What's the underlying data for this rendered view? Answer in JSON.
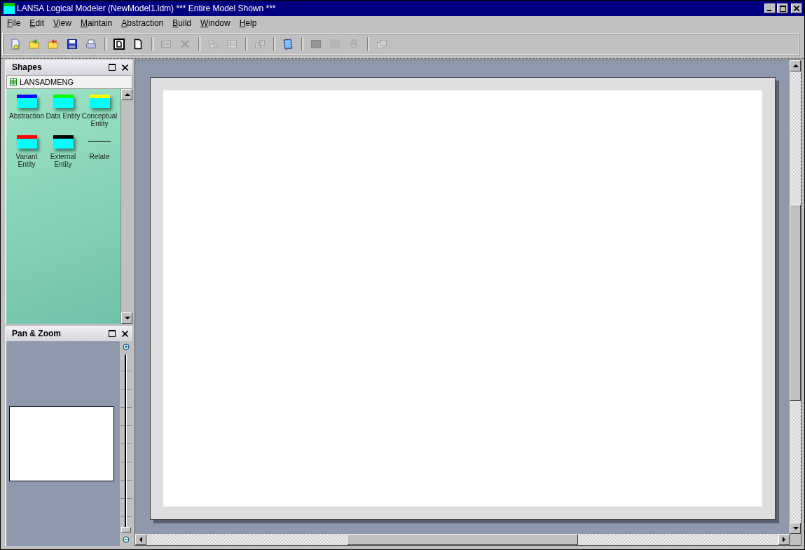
{
  "window": {
    "title": "LANSA Logical Modeler (NewModel1.ldm) *** Entire Model Shown ***"
  },
  "menu": [
    "File",
    "Edit",
    "View",
    "Maintain",
    "Abstraction",
    "Build",
    "Window",
    "Help"
  ],
  "toolbar": [
    [
      {
        "kind": "new",
        "disabled": false
      },
      {
        "kind": "import",
        "disabled": false
      },
      {
        "kind": "export",
        "disabled": false
      },
      {
        "kind": "save",
        "disabled": false
      },
      {
        "kind": "print",
        "disabled": false
      }
    ],
    [
      {
        "kind": "page-bold",
        "disabled": false
      },
      {
        "kind": "page",
        "disabled": false
      }
    ],
    [
      {
        "kind": "properties",
        "disabled": true
      },
      {
        "kind": "delete",
        "disabled": true
      }
    ],
    [
      {
        "kind": "cubes",
        "disabled": true
      },
      {
        "kind": "table",
        "disabled": true
      }
    ],
    [
      {
        "kind": "link",
        "disabled": true
      }
    ],
    [
      {
        "kind": "notepad",
        "disabled": false
      }
    ],
    [
      {
        "kind": "block",
        "disabled": true
      },
      {
        "kind": "grid",
        "disabled": true
      },
      {
        "kind": "stack",
        "disabled": true
      }
    ],
    [
      {
        "kind": "copy",
        "disabled": true
      }
    ]
  ],
  "shapes_panel": {
    "title": "Shapes",
    "group": "LANSADMENG",
    "items": [
      {
        "label": "Abstraction",
        "kind": "entity",
        "color": "#0000ff"
      },
      {
        "label": "Data Entity",
        "kind": "entity",
        "color": "#00ff00"
      },
      {
        "label": "Conceptual Entity",
        "kind": "entity",
        "color": "#ffff00"
      },
      {
        "label": "Variant Entity",
        "kind": "entity",
        "color": "#ff0000"
      },
      {
        "label": "External Entity",
        "kind": "entity",
        "color": "#000000"
      },
      {
        "label": "Relate",
        "kind": "relation"
      }
    ]
  },
  "pan_zoom_panel": {
    "title": "Pan & Zoom",
    "zoom": {
      "level": 0
    }
  }
}
